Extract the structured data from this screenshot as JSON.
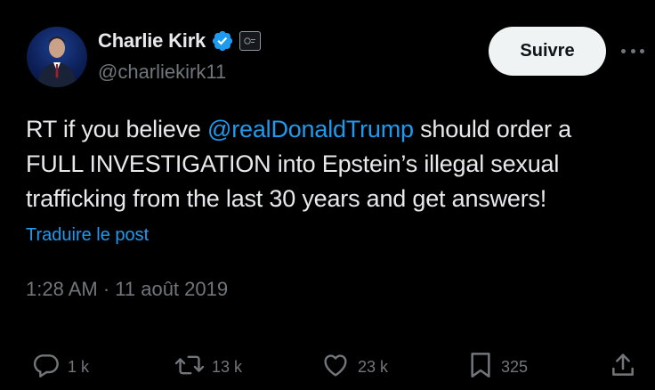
{
  "author": {
    "display_name": "Charlie Kirk",
    "handle": "@charliekirk11",
    "verified": true,
    "badge": "affiliate-badge"
  },
  "header": {
    "follow_label": "Suivre",
    "more_icon": "more-horizontal-icon"
  },
  "tweet": {
    "line1_before": "RT if you believe ",
    "mention": "@realDonaldTrump",
    "line1_after": " should order a",
    "line2": "FULL INVESTIGATION into Epstein’s illegal sexual",
    "line3": "trafficking from the last 30 years and get answers!",
    "translate_label": "Traduire le post",
    "timestamp": "1:28 AM · 11 août 2019"
  },
  "actions": [
    {
      "name": "reply",
      "icon": "reply-icon",
      "count": "1 k"
    },
    {
      "name": "retweet",
      "icon": "retweet-icon",
      "count": "13 k"
    },
    {
      "name": "like",
      "icon": "heart-icon",
      "count": "23 k"
    },
    {
      "name": "bookmark",
      "icon": "bookmark-icon",
      "count": "325"
    },
    {
      "name": "share",
      "icon": "share-icon",
      "count": ""
    }
  ],
  "colors": {
    "background": "#000000",
    "text": "#e7e9ea",
    "muted": "#71767b",
    "link": "#1d9bf0",
    "verified": "#1d9bf0",
    "button_bg": "#eff3f4"
  }
}
